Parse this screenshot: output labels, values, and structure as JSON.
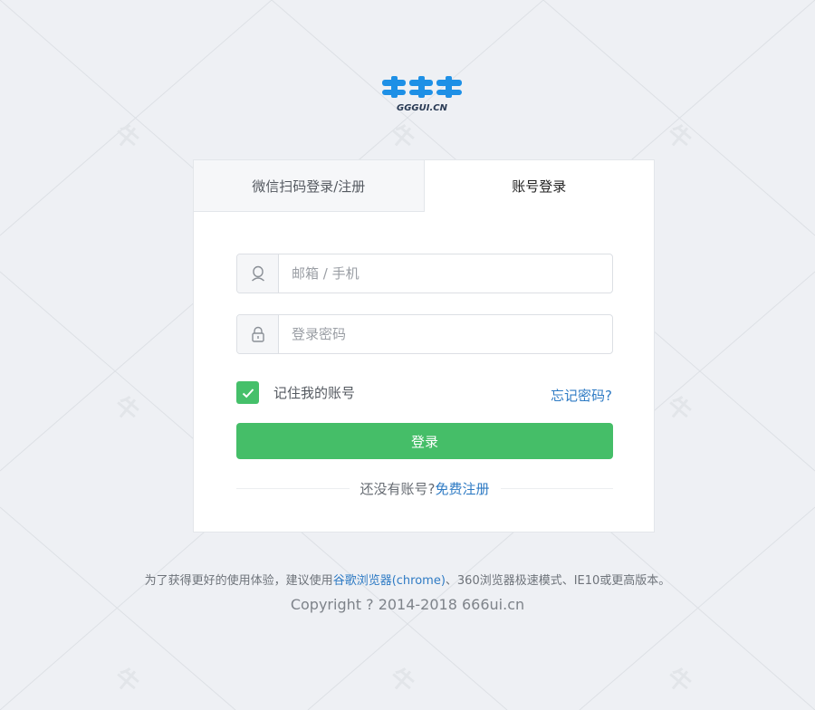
{
  "logo": {
    "text": "GGGUI.CN",
    "brand_color": "#1e90e6"
  },
  "tabs": [
    {
      "label": "微信扫码登录/注册",
      "active": false
    },
    {
      "label": "账号登录",
      "active": true
    }
  ],
  "form": {
    "account": {
      "placeholder": "邮箱 / 手机",
      "value": "",
      "icon": "user-icon"
    },
    "password": {
      "placeholder": "登录密码",
      "value": "",
      "icon": "lock-icon"
    },
    "remember": {
      "label": "记住我的账号",
      "checked": true
    },
    "forgot_label": "忘记密码?",
    "submit_label": "登录",
    "register_prompt": "还没有账号?",
    "register_link": "免费注册"
  },
  "footer": {
    "notice_prefix": "为了获得更好的使用体验，建议使用",
    "notice_link": "谷歌浏览器(chrome)",
    "notice_suffix": "、360浏览器极速模式、IE10或更高版本。",
    "copyright": "Copyright ? 2014-2018 666ui.cn"
  },
  "colors": {
    "accent_green": "#45be68",
    "link_blue": "#2f7bc4",
    "background": "#eef0f4"
  }
}
